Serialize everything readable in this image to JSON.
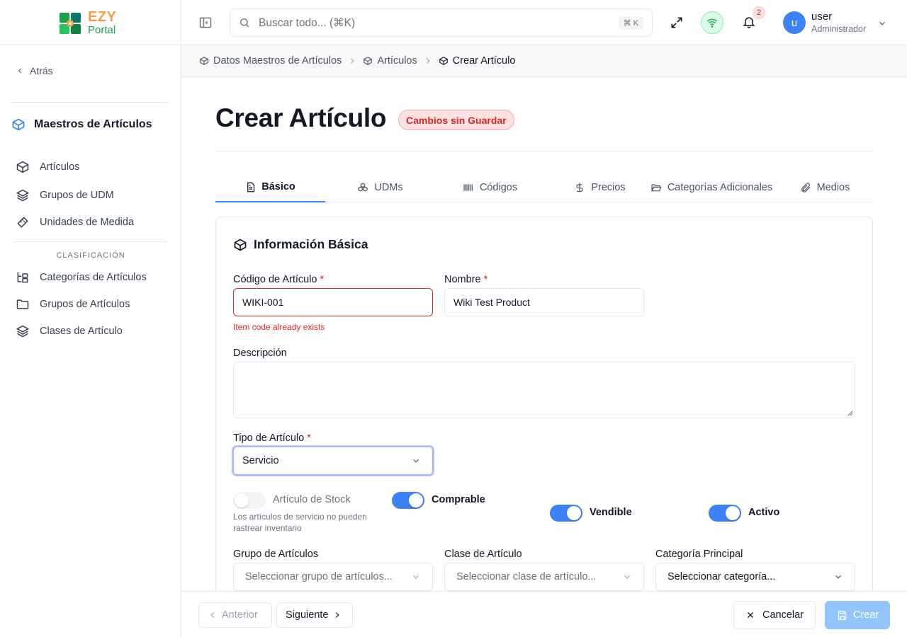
{
  "app": {
    "logo_primary": "EZY",
    "logo_secondary": "Portal"
  },
  "sidebar": {
    "back_label": "Atrás",
    "section_title": "Maestros de Artículos",
    "items": [
      {
        "label": "Artículos",
        "icon": "box-icon"
      },
      {
        "label": "Grupos de UDM",
        "icon": "layers-icon"
      },
      {
        "label": "Unidades de Medida",
        "icon": "ruler-icon"
      }
    ],
    "group_label": "CLASIFICACIÓN",
    "group_items": [
      {
        "label": "Categorías de Artículos",
        "icon": "tree-icon"
      },
      {
        "label": "Grupos de Artículos",
        "icon": "folder-icon"
      },
      {
        "label": "Clases de Artículo",
        "icon": "layers-icon"
      }
    ]
  },
  "topbar": {
    "search_placeholder": "Buscar todo... (⌘K)",
    "search_kbd": "⌘ K",
    "notifications_count": "2",
    "user_initial": "u",
    "user_name": "user",
    "user_role": "Administrador"
  },
  "breadcrumb": [
    "Datos Maestros de Artículos",
    "Artículos",
    "Crear Artículo"
  ],
  "page": {
    "title": "Crear Artículo",
    "badge": "Cambios sin Guardar"
  },
  "tabs": [
    {
      "label": "Básico",
      "icon": "file-text-icon",
      "active": true
    },
    {
      "label": "UDMs",
      "icon": "boxes-icon"
    },
    {
      "label": "Códigos",
      "icon": "barcode-icon"
    },
    {
      "label": "Precios",
      "icon": "dollar-icon"
    },
    {
      "label": "Categorías Adicionales",
      "icon": "folder-open-icon"
    },
    {
      "label": "Medios",
      "icon": "paperclip-icon"
    }
  ],
  "form": {
    "section_title": "Información Básica",
    "item_code": {
      "label": "Código de Artículo",
      "required": "*",
      "value": "WIKI-001",
      "error": "Item code already exists"
    },
    "name": {
      "label": "Nombre",
      "required": "*",
      "value": "Wiki Test Product"
    },
    "description": {
      "label": "Descripción",
      "value": ""
    },
    "item_type": {
      "label": "Tipo de Artículo",
      "required": "*",
      "value": "Servicio"
    },
    "toggles": {
      "stock": {
        "label": "Artículo de Stock",
        "on": false,
        "hint": "Los artículos de servicio no pueden rastrear inventario"
      },
      "purchasable": {
        "label": "Comprable",
        "on": true
      },
      "sellable": {
        "label": "Vendible",
        "on": true
      },
      "active": {
        "label": "Activo",
        "on": true
      }
    },
    "item_group": {
      "label": "Grupo de Artículos",
      "placeholder": "Seleccionar grupo de artículos..."
    },
    "item_class": {
      "label": "Clase de Artículo",
      "placeholder": "Seleccionar clase de artículo..."
    },
    "main_category": {
      "label": "Categoría Principal",
      "placeholder": "Seleccionar categoría..."
    }
  },
  "footer": {
    "prev_label": "Anterior",
    "next_label": "Siguiente",
    "cancel_label": "Cancelar",
    "create_label": "Crear"
  },
  "colors": {
    "accent": "#3b82f6",
    "error": "#dc2626",
    "brand_orange": "#f59e42",
    "brand_green": "#16a34a"
  }
}
